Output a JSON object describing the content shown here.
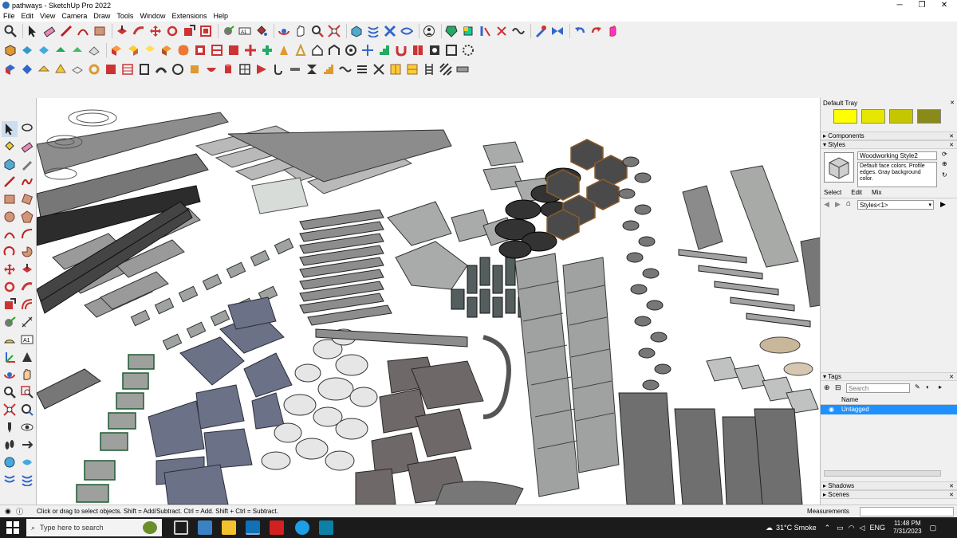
{
  "window": {
    "title": "pathways - SketchUp Pro 2022",
    "controls": [
      "─",
      "❐",
      "✕"
    ]
  },
  "menu": [
    "File",
    "Edit",
    "View",
    "Camera",
    "Draw",
    "Tools",
    "Window",
    "Extensions",
    "Help"
  ],
  "tray": {
    "title": "Default Tray",
    "swatch_colors": [
      "#ffff00",
      "#e6e600",
      "#c6c600",
      "#8a8a1a"
    ],
    "components_label": "Components",
    "styles_label": "Styles",
    "style_name": "Woodworking Style2",
    "style_description": "Default face colors. Profile edges. Gray background color.",
    "style_tabs": [
      "Select",
      "Edit",
      "Mix"
    ],
    "style_dropdown": "Styles<1>",
    "tags_label": "Tags",
    "tags_search_placeholder": "Search",
    "tags_column_name": "Name",
    "tag_item": "Untagged",
    "shadows_label": "Shadows",
    "scenes_label": "Scenes"
  },
  "status": {
    "message": "Click or drag to select objects. Shift = Add/Subtract. Ctrl = Add. Shift + Ctrl = Subtract.",
    "measurements_label": "Measurements"
  },
  "taskbar": {
    "search_placeholder": "Type here to search",
    "weather": "31°C  Smoke",
    "language": "ENG",
    "time": "11:48 PM",
    "date": "7/31/2023"
  },
  "colors": {
    "selection_blue": "#1e90ff",
    "ground": "#ffffff"
  }
}
